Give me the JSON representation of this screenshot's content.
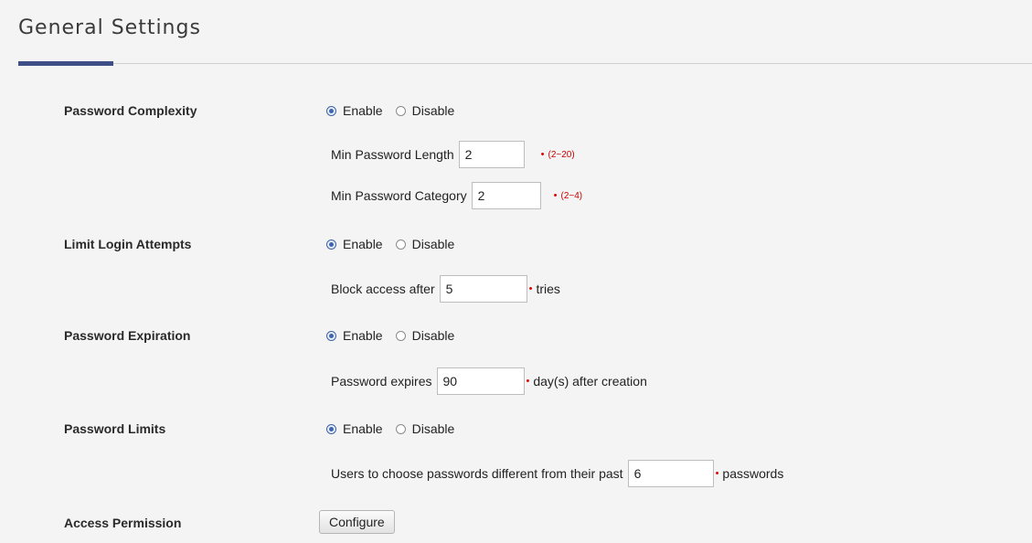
{
  "page": {
    "title": "General Settings"
  },
  "options": {
    "enable": "Enable",
    "disable": "Disable"
  },
  "password_complexity": {
    "label": "Password Complexity",
    "min_length_label": "Min Password Length",
    "min_length_value": "2",
    "min_length_range": "(2~20)",
    "min_category_label": "Min Password Category",
    "min_category_value": "2",
    "min_category_range": "(2~4)"
  },
  "limit_login": {
    "label": "Limit Login Attempts",
    "block_label": "Block access after",
    "block_value": "5",
    "block_suffix": "tries"
  },
  "password_expiration": {
    "label": "Password Expiration",
    "expires_label": "Password expires",
    "expires_value": "90",
    "expires_suffix": "day(s) after creation"
  },
  "password_limits": {
    "label": "Password Limits",
    "history_label": "Users to choose passwords different from their past",
    "history_value": "6",
    "history_suffix": "passwords"
  },
  "access_permission": {
    "label": "Access Permission",
    "button": "Configure"
  },
  "required_marker": "•"
}
